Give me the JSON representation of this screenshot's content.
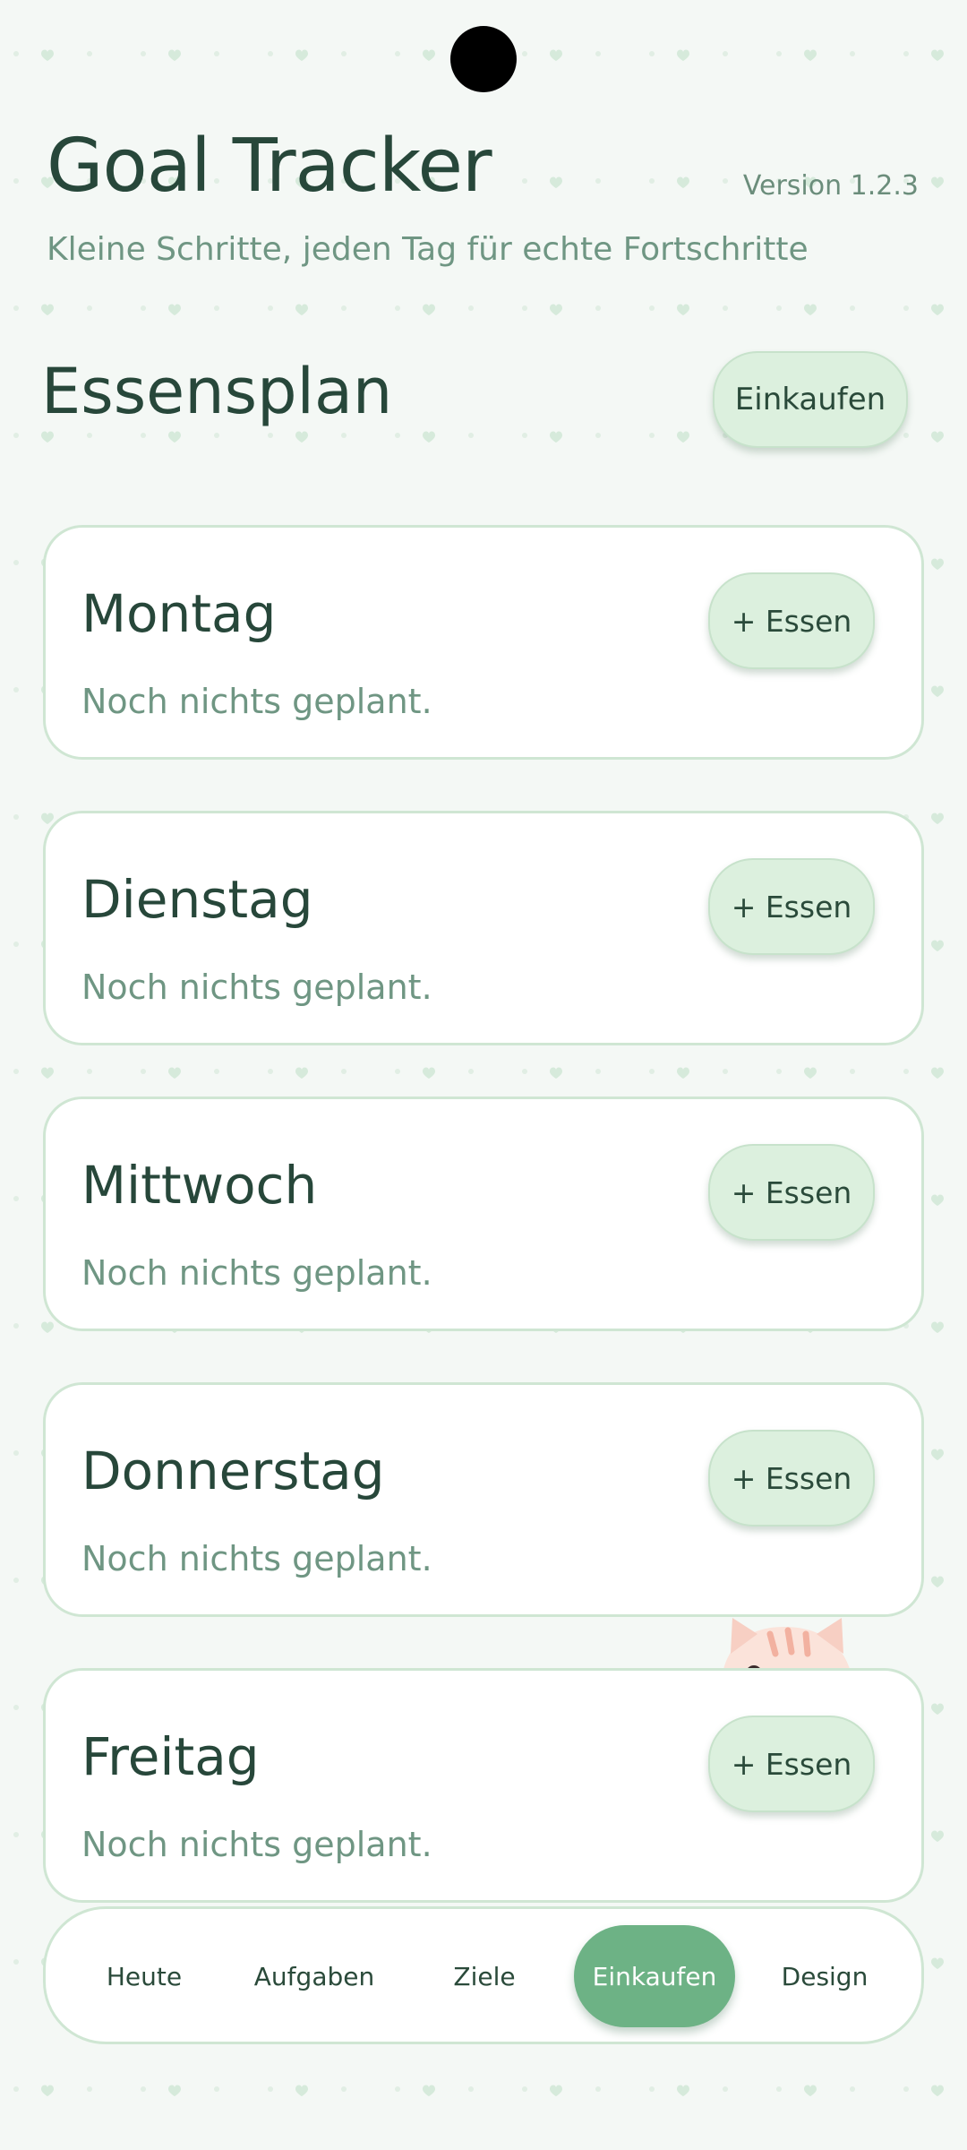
{
  "header": {
    "title": "Goal Tracker",
    "version": "Version 1.2.3",
    "subtitle": "Kleine Schritte, jeden Tag für echte Fortschritte"
  },
  "section": {
    "title": "Essensplan",
    "shop_button": "Einkaufen"
  },
  "days": [
    {
      "name": "Montag",
      "empty_text": "Noch nichts geplant.",
      "add_label": "+ Essen"
    },
    {
      "name": "Dienstag",
      "empty_text": "Noch nichts geplant.",
      "add_label": "+ Essen"
    },
    {
      "name": "Mittwoch",
      "empty_text": "Noch nichts geplant.",
      "add_label": "+ Essen"
    },
    {
      "name": "Donnerstag",
      "empty_text": "Noch nichts geplant.",
      "add_label": "+ Essen"
    },
    {
      "name": "Freitag",
      "empty_text": "Noch nichts geplant.",
      "add_label": "+ Essen"
    }
  ],
  "nav": {
    "items": [
      "Heute",
      "Aufgaben",
      "Ziele",
      "Einkaufen",
      "Design"
    ],
    "active": "Einkaufen"
  },
  "colors": {
    "background": "#f4f8f5",
    "accent": "#6db285",
    "button_bg": "#dcf0de",
    "text_dark": "#27473a",
    "text_muted": "#6f9683"
  }
}
